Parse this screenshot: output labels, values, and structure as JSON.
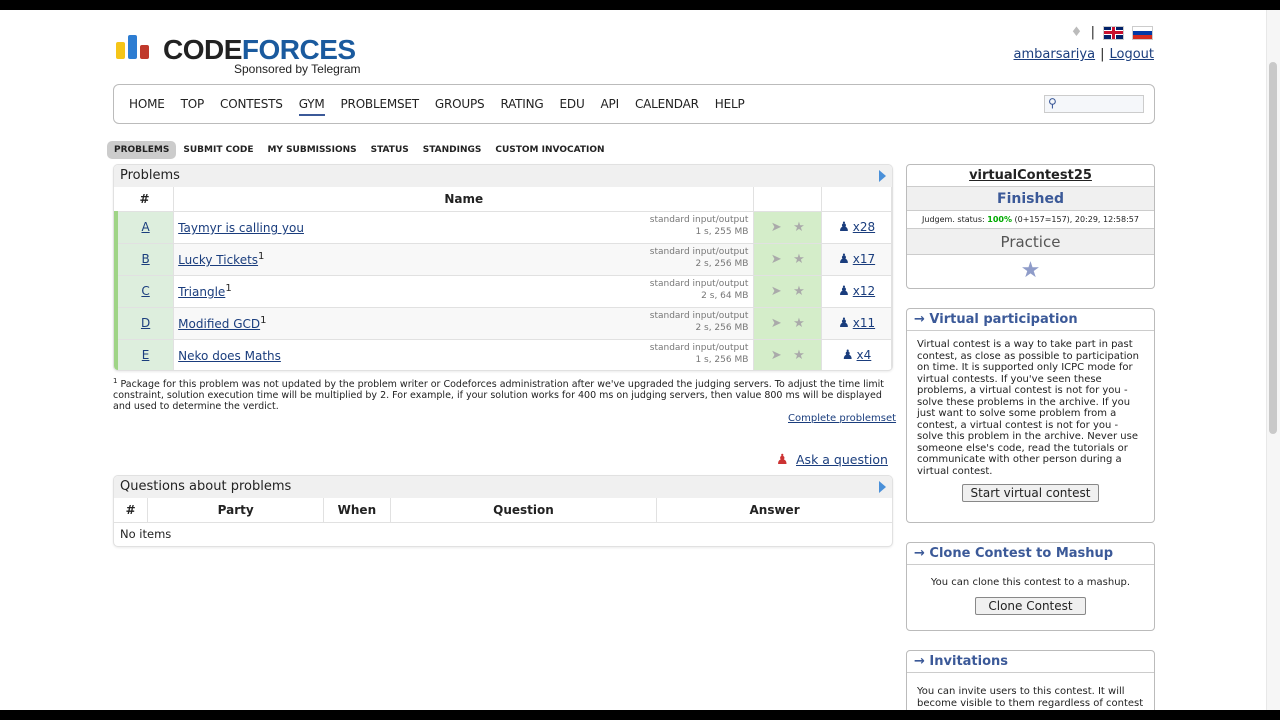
{
  "header": {
    "logo_first": "C",
    "logo_rest_dark": "ODE",
    "logo_rest": "FORCES",
    "sponsor": "Sponsored by Telegram",
    "user": "ambarsariya",
    "logout": "Logout",
    "bar": "|"
  },
  "menu": [
    "HOME",
    "TOP",
    "CONTESTS",
    "GYM",
    "PROBLEMSET",
    "GROUPS",
    "RATING",
    "EDU",
    "API",
    "CALENDAR",
    "HELP"
  ],
  "submenu": [
    "PROBLEMS",
    "SUBMIT CODE",
    "MY SUBMISSIONS",
    "STATUS",
    "STANDINGS",
    "CUSTOM INVOCATION"
  ],
  "problems_panel": {
    "title": "Problems",
    "col_hash": "#",
    "col_name": "Name",
    "rows": [
      {
        "id": "A",
        "name": "Taymyr is calling you",
        "sup": "",
        "io": "standard input/output",
        "limits": "1 s, 255 MB",
        "solved": "x28"
      },
      {
        "id": "B",
        "name": "Lucky Tickets",
        "sup": "1",
        "io": "standard input/output",
        "limits": "2 s, 256 MB",
        "solved": "x17"
      },
      {
        "id": "C",
        "name": "Triangle",
        "sup": "1",
        "io": "standard input/output",
        "limits": "2 s, 64 MB",
        "solved": "x12"
      },
      {
        "id": "D",
        "name": "Modified GCD",
        "sup": "1",
        "io": "standard input/output",
        "limits": "2 s, 256 MB",
        "solved": "x11"
      },
      {
        "id": "E",
        "name": "Neko does Maths",
        "sup": "",
        "io": "standard input/output",
        "limits": "1 s, 256 MB",
        "solved": "x4"
      }
    ]
  },
  "footnote": {
    "mark": "1",
    "text": "Package for this problem was not updated by the problem writer or Codeforces administration after we've upgraded the judging servers. To adjust the time limit constraint, solution execution time will be multiplied by 2. For example, if your solution works for 400 ms on judging servers, then value 800 ms will be displayed and used to determine the verdict."
  },
  "complete_link": "Complete problemset",
  "ask_link": "Ask a question",
  "questions_panel": {
    "title": "Questions about problems",
    "cols": [
      "#",
      "Party",
      "When",
      "Question",
      "Answer"
    ],
    "empty": "No items"
  },
  "contest_box": {
    "name": "virtualContest25",
    "status": "Finished",
    "judgem_label": "Judgem. status:",
    "judgem_pct": "100%",
    "judgem_detail": "(0+157=157), 20:29, 12:58:57",
    "practice": "Practice"
  },
  "virtual": {
    "title": "→ Virtual participation",
    "text": "Virtual contest is a way to take part in past contest, as close as possible to participation on time. It is supported only ICPC mode for virtual contests. If you've seen these problems, a virtual contest is not for you - solve these problems in the archive. If you just want to solve some problem from a contest, a virtual contest is not for you - solve this problem in the archive. Never use someone else's code, read the tutorials or communicate with other person during a virtual contest.",
    "button": "Start virtual contest"
  },
  "clone": {
    "title": "→ Clone Contest to Mashup",
    "text": "You can clone this contest to a mashup.",
    "button": "Clone Contest"
  },
  "invitations": {
    "title": "→ Invitations",
    "text": "You can invite users to this contest. It will become visible to them regardless of contest"
  },
  "colors": {
    "brand_blue": "#1a5a9e",
    "link": "#1a3d7d",
    "accepted_green": "#d4edc9",
    "logo_yellow": "#f5c518",
    "logo_blue": "#2d7dd2",
    "logo_red": "#c0392b"
  }
}
